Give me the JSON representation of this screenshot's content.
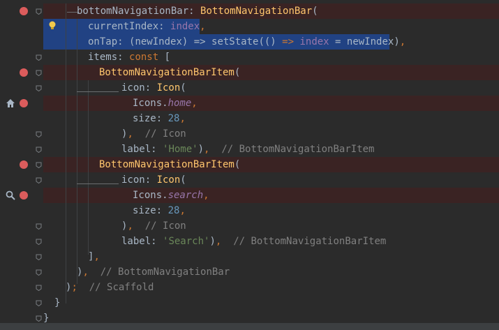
{
  "colors": {
    "background": "#2b2b2b",
    "selection": "#214283",
    "breakpoint": "#db5c5c",
    "breakpoint_row": "#3a2323",
    "keyword": "#cc7832",
    "class": "#ffc66d",
    "number": "#6897bb",
    "string": "#6a8759",
    "comment": "#808080",
    "static_member": "#9876aa",
    "text": "#a9b7c6"
  },
  "gutter": {
    "icons": [
      "intention-bulb-icon",
      "breakpoint-icon",
      "home-icon",
      "search-icon",
      "fold-icon"
    ]
  },
  "lines": [
    {
      "tokens": [
        [
          "field",
          "bottomNavigationBar"
        ],
        [
          "punc",
          ": "
        ],
        [
          "class",
          "BottomNavigationBar"
        ],
        [
          "punc",
          "("
        ]
      ]
    },
    {
      "tokens": [
        [
          "field",
          "currentIndex"
        ],
        [
          "punc",
          ": "
        ],
        [
          "named",
          "index"
        ],
        [
          "kw",
          ","
        ]
      ]
    },
    {
      "tokens": [
        [
          "field",
          "onTap"
        ],
        [
          "punc",
          ": (newIndex) => setState(() "
        ],
        [
          "kw",
          "=>"
        ],
        [
          "punc",
          " "
        ],
        [
          "named",
          "index"
        ],
        [
          "punc",
          " = newIndex)"
        ],
        [
          "kw",
          ","
        ]
      ]
    },
    {
      "tokens": [
        [
          "field",
          "items"
        ],
        [
          "punc",
          ": "
        ],
        [
          "kw",
          "const"
        ],
        [
          "punc",
          " ["
        ]
      ]
    },
    {
      "tokens": [
        [
          "class",
          "BottomNavigationBarItem"
        ],
        [
          "punc",
          "("
        ]
      ]
    },
    {
      "tokens": [
        [
          "field",
          "icon"
        ],
        [
          "punc",
          ": "
        ],
        [
          "class",
          "Icon"
        ],
        [
          "punc",
          "("
        ]
      ]
    },
    {
      "tokens": [
        [
          "punc",
          "Icons."
        ],
        [
          "static",
          "home"
        ],
        [
          "kw",
          ","
        ]
      ]
    },
    {
      "tokens": [
        [
          "field",
          "size"
        ],
        [
          "punc",
          ": "
        ],
        [
          "num",
          "28"
        ],
        [
          "kw",
          ","
        ]
      ]
    },
    {
      "tokens": [
        [
          "punc",
          ")"
        ],
        [
          "kw",
          ","
        ],
        [
          "punc",
          "  "
        ],
        [
          "cmt",
          "// Icon"
        ]
      ]
    },
    {
      "tokens": [
        [
          "field",
          "label"
        ],
        [
          "punc",
          ": "
        ],
        [
          "str",
          "'Home'"
        ],
        [
          "punc",
          ")"
        ],
        [
          "kw",
          ","
        ],
        [
          "punc",
          "  "
        ],
        [
          "cmt",
          "// BottomNavigationBarItem"
        ]
      ]
    },
    {
      "tokens": [
        [
          "class",
          "BottomNavigationBarItem"
        ],
        [
          "punc",
          "("
        ]
      ]
    },
    {
      "tokens": [
        [
          "field",
          "icon"
        ],
        [
          "punc",
          ": "
        ],
        [
          "class",
          "Icon"
        ],
        [
          "punc",
          "("
        ]
      ]
    },
    {
      "tokens": [
        [
          "punc",
          "Icons."
        ],
        [
          "static",
          "search"
        ],
        [
          "kw",
          ","
        ]
      ]
    },
    {
      "tokens": [
        [
          "field",
          "size"
        ],
        [
          "punc",
          ": "
        ],
        [
          "num",
          "28"
        ],
        [
          "kw",
          ","
        ]
      ]
    },
    {
      "tokens": [
        [
          "punc",
          ")"
        ],
        [
          "kw",
          ","
        ],
        [
          "punc",
          "  "
        ],
        [
          "cmt",
          "// Icon"
        ]
      ]
    },
    {
      "tokens": [
        [
          "field",
          "label"
        ],
        [
          "punc",
          ": "
        ],
        [
          "str",
          "'Search'"
        ],
        [
          "punc",
          ")"
        ],
        [
          "kw",
          ","
        ],
        [
          "punc",
          "  "
        ],
        [
          "cmt",
          "// BottomNavigationBarItem"
        ]
      ]
    },
    {
      "tokens": [
        [
          "punc",
          "]"
        ],
        [
          "kw",
          ","
        ]
      ]
    },
    {
      "tokens": [
        [
          "punc",
          ")"
        ],
        [
          "kw",
          ","
        ],
        [
          "punc",
          "  "
        ],
        [
          "cmt",
          "// BottomNavigationBar"
        ]
      ]
    },
    {
      "tokens": [
        [
          "punc",
          ")"
        ],
        [
          "kw",
          ";"
        ],
        [
          "punc",
          "  "
        ],
        [
          "cmt",
          "// Scaffold"
        ]
      ]
    },
    {
      "tokens": [
        [
          "punc",
          "}"
        ]
      ]
    },
    {
      "tokens": [
        [
          "punc",
          "}"
        ]
      ]
    }
  ]
}
